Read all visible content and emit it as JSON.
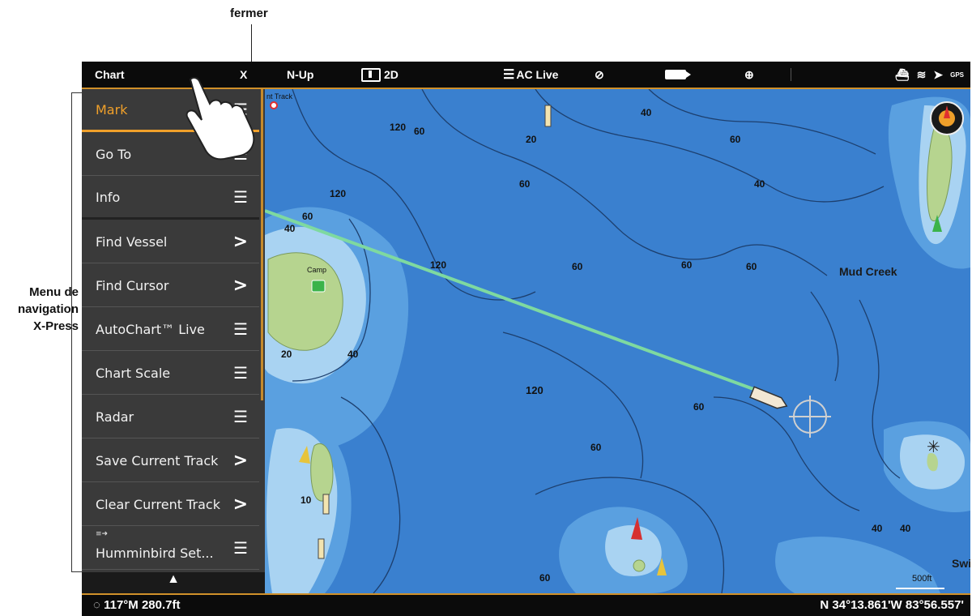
{
  "callouts": {
    "close": "fermer",
    "menu_lines": [
      "Menu de",
      "navigation",
      "X-Press"
    ]
  },
  "topbar": {
    "title": "Chart",
    "close_glyph": "X",
    "north_up": "N-Up",
    "view_2d": "2D",
    "autochart_live": "AC Live",
    "gps": "GPS"
  },
  "menu": {
    "items": [
      {
        "label": "Mark",
        "icon": "list-icon",
        "selected": true
      },
      {
        "label": "Go To",
        "icon": "list-icon"
      },
      {
        "label": "Info",
        "icon": "list-icon"
      },
      {
        "label": "Find Vessel",
        "icon": "chevron-right-icon"
      },
      {
        "label": "Find Cursor",
        "icon": "chevron-right-icon"
      },
      {
        "label": "AutoChart™ Live",
        "icon": "list-icon"
      },
      {
        "label": "Chart Scale",
        "icon": "list-icon"
      },
      {
        "label": "Radar",
        "icon": "list-icon"
      },
      {
        "label": "Save Current Track",
        "icon": "chevron-right-icon"
      },
      {
        "label": "Clear Current Track",
        "icon": "chevron-right-icon"
      },
      {
        "label": "Humminbird Set...",
        "icon": "list-icon"
      }
    ],
    "scroll_up_glyph": "▲"
  },
  "map": {
    "track_label": "nt Track",
    "camp_label": "Camp",
    "place_label": "Mud Creek",
    "place_label_2": "Swi",
    "scale": "500ft",
    "depths": [
      "60",
      "120",
      "40",
      "20",
      "60",
      "40",
      "60",
      "120",
      "60",
      "40",
      "120",
      "60",
      "60",
      "60",
      "20",
      "40",
      "10",
      "60",
      "60",
      "40",
      "40",
      "60"
    ]
  },
  "bottombar": {
    "heading": "117°M",
    "depth": "280.7ft",
    "position": "N 34°13.861'W 83°56.557'"
  },
  "colors": {
    "water_deep": "#3a80cf",
    "water_mid": "#5aa0e0",
    "water_shallow": "#a9d3f2",
    "land": "#b6d48f",
    "accent": "#f0a02a",
    "menu_bg": "#3a3a3a"
  }
}
